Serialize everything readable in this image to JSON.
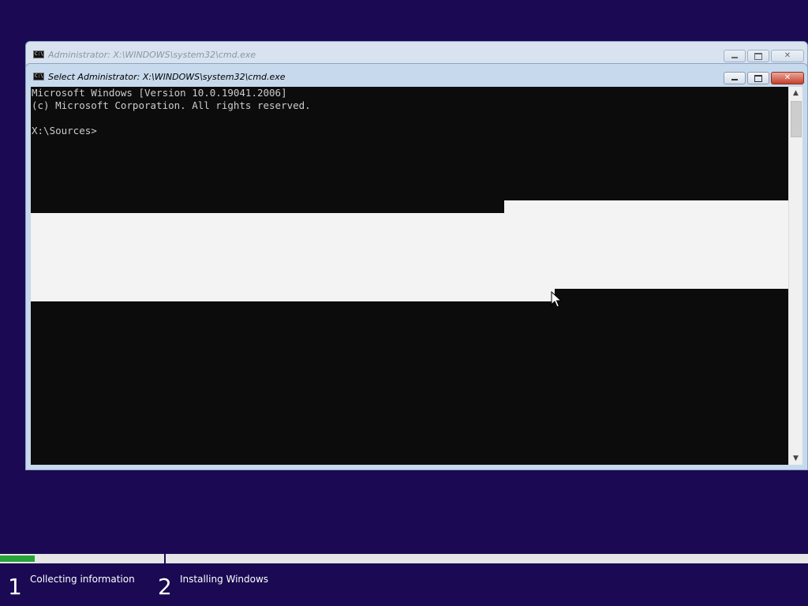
{
  "back_window": {
    "title": "Administrator: X:\\WINDOWS\\system32\\cmd.exe",
    "icon": "cmd-icon"
  },
  "front_window": {
    "title": "Select Administrator: X:\\WINDOWS\\system32\\cmd.exe",
    "icon": "cmd-icon",
    "close_color": "#c4402c"
  },
  "console": {
    "lines": [
      "Microsoft Windows [Version 10.0.19041.2006]",
      "(c) Microsoft Corporation. All rights reserved.",
      "",
      "X:\\Sources>"
    ],
    "background": "#0c0c0c",
    "text_color": "#cccccc",
    "selection_color": "#f3f3f3"
  },
  "setup_progress": {
    "fill_fraction": 0.043,
    "fill_color": "#27a339",
    "steps": [
      {
        "number": "1",
        "label": "Collecting information"
      },
      {
        "number": "2",
        "label": "Installing Windows"
      }
    ]
  },
  "colors": {
    "desktop": "#1b0a53"
  }
}
